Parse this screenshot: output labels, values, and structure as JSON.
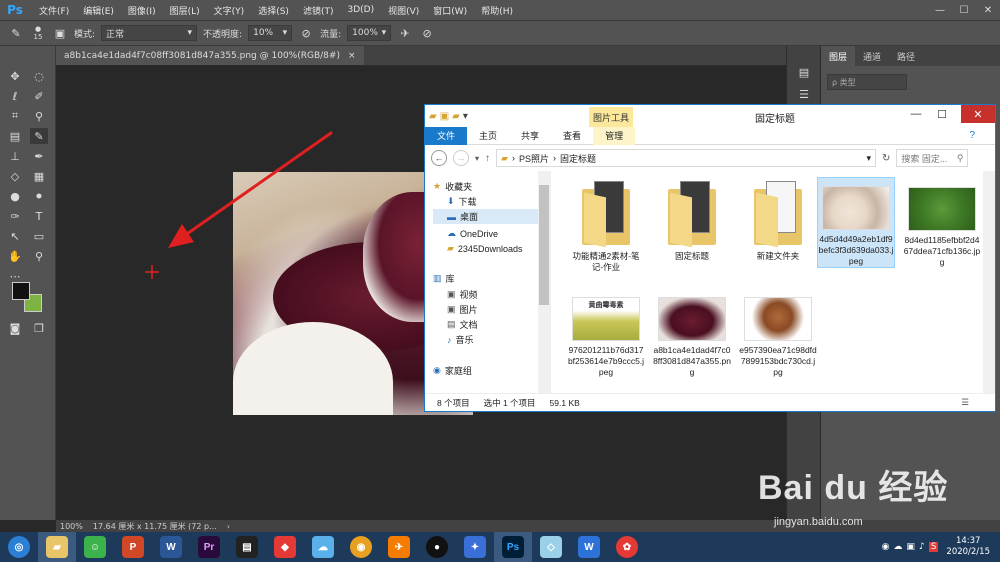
{
  "ps": {
    "logo": "Ps",
    "menu": [
      "文件(F)",
      "编辑(E)",
      "图像(I)",
      "图层(L)",
      "文字(Y)",
      "选择(S)",
      "滤镜(T)",
      "3D(D)",
      "视图(V)",
      "窗口(W)",
      "帮助(H)"
    ],
    "window_controls": [
      "—",
      "☐",
      "✕"
    ],
    "options": {
      "brush_size": "15",
      "mode_label": "模式:",
      "mode_value": "正常",
      "opacity_label": "不透明度:",
      "opacity_value": "10%",
      "flow_label": "流量:",
      "flow_value": "100%"
    },
    "doc_tab": "a8b1ca4e1dad4f7c08ff3081d847a355.png @ 100%(RGB/8#)",
    "doc_tab_close": "×",
    "panels": {
      "tabs": [
        "图层",
        "通道",
        "路径"
      ],
      "filter_placeholder": "ρ 类型"
    },
    "status": {
      "zoom": "100%",
      "doc_size": "17.64 厘米 x 11.75 厘米 (72 p...",
      "arrow": "›"
    }
  },
  "explorer": {
    "title": "固定标题",
    "context_tab": "图片工具",
    "ribbon_tabs": [
      "文件",
      "主页",
      "共享",
      "查看",
      "管理"
    ],
    "path": [
      "PS照片",
      "固定标题"
    ],
    "search_placeholder": "搜索 固定...",
    "nav": {
      "favorites": "收藏夹",
      "downloads": "下载",
      "desktop": "桌面",
      "onedrive": "OneDrive",
      "downloads2345": "2345Downloads",
      "library": "库",
      "videos": "视频",
      "pictures": "图片",
      "documents": "文档",
      "music": "音乐",
      "homegroup": "家庭组"
    },
    "files": [
      {
        "name": "功能精通2素材-笔记-作业",
        "kind": "folder"
      },
      {
        "name": "固定标题",
        "kind": "folder"
      },
      {
        "name": "新建文件夹",
        "kind": "folder"
      },
      {
        "name": "4d5d4d49a2eb1df9befc3f3d639da033.jpeg",
        "kind": "porridge"
      },
      {
        "name": "8d4ed1185efbbf2d467ddea71cfb136c.jpg",
        "kind": "leaves"
      },
      {
        "name": "976201211b76d317bf253614e7b9ccc5.jpeg",
        "kind": "rice"
      },
      {
        "name": "a8b1ca4e1dad4f7c08ff3081d847a355.png",
        "kind": "jam"
      },
      {
        "name": "e957390ea71c98dfd7899153bdc730cd.jpg",
        "kind": "tree"
      }
    ],
    "thumb_text_rice": "黄曲霉毒素",
    "status_count": "8 个项目",
    "status_selected": "选中 1 个项目",
    "status_size": "59.1 KB"
  },
  "taskbar": {
    "clock_time": "14:37",
    "clock_date": "2020/2/15"
  },
  "watermark": {
    "brand": "Bai du 经验",
    "url": "jingyan.baidu.com"
  },
  "colors": {
    "ps_bg": "#535353",
    "canvas": "#282828",
    "arrow": "#e02020",
    "explorer_accent": "#1979ca",
    "context_tab": "#fbe89a",
    "taskbar": "#1e3a5a"
  }
}
